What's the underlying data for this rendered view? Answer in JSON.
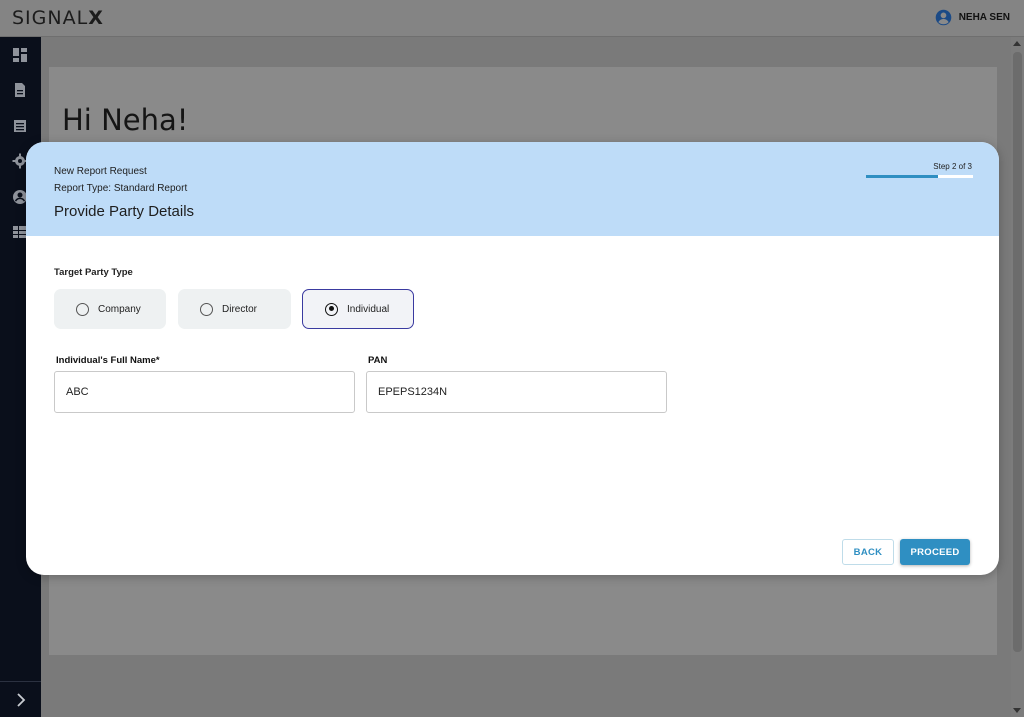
{
  "app": {
    "brand_light": "SIGNAL",
    "brand_bold": "X",
    "user_name": "NEHA SEN"
  },
  "sidebar": {
    "items": [
      {
        "icon": "dashboard-icon"
      },
      {
        "icon": "document-icon"
      },
      {
        "icon": "list-icon"
      },
      {
        "icon": "gear-icon"
      },
      {
        "icon": "account-icon"
      },
      {
        "icon": "table-icon"
      }
    ],
    "toggle_icon": "chevron-right-icon"
  },
  "main": {
    "greeting": "Hi Neha!"
  },
  "modal": {
    "line1": "New Report Request",
    "line2": "Report Type: Standard Report",
    "title": "Provide Party Details",
    "step_label": "Step 2 of 3",
    "progress": 0.67,
    "party_type_label": "Target Party Type",
    "party_types": [
      {
        "label": "Company",
        "selected": false
      },
      {
        "label": "Director",
        "selected": false
      },
      {
        "label": "Individual",
        "selected": true
      }
    ],
    "fields": {
      "full_name": {
        "label": "Individual's Full Name*",
        "value": "ABC"
      },
      "pan": {
        "label": "PAN",
        "value": "EPEPS1234N"
      }
    },
    "back_label": "BACK",
    "proceed_label": "PROCEED"
  },
  "colors": {
    "accent": "#2f8fc2",
    "header_bg": "#bedcf8",
    "sidebar_bg": "#0a0f1b",
    "selected_border": "#3a3aa0"
  }
}
